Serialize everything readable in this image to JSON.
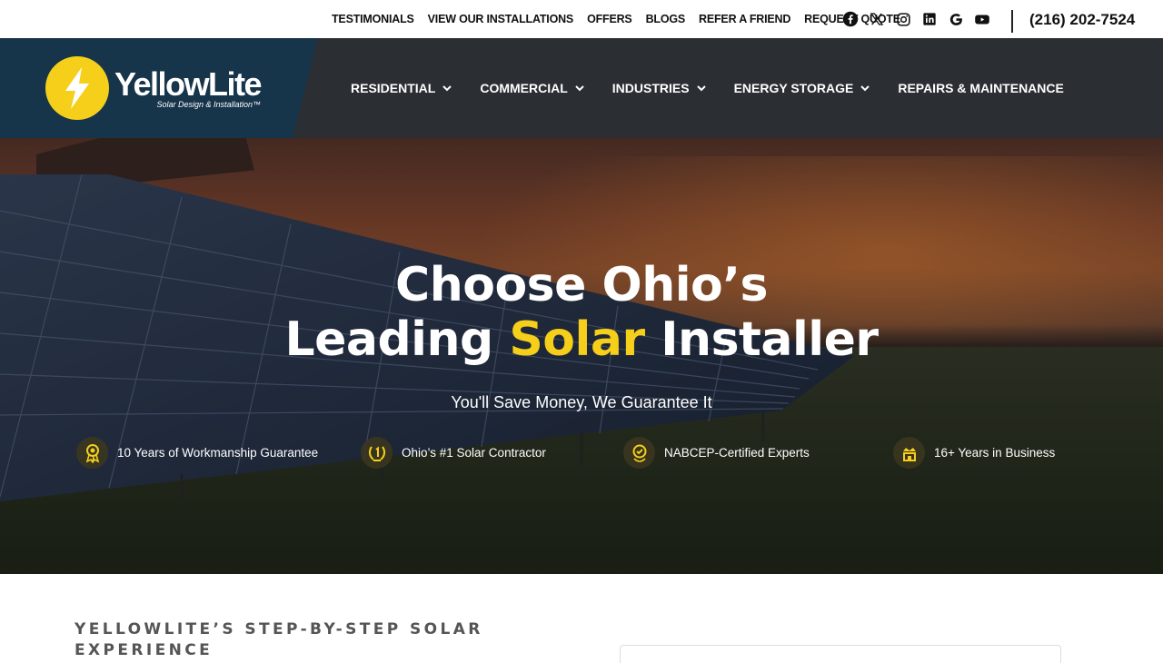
{
  "topbar": {
    "links": [
      "TESTIMONIALS",
      "VIEW OUR INSTALLATIONS",
      "OFFERS",
      "BLOGS",
      "REFER A FRIEND",
      "REQUEST QUOTE"
    ],
    "socials": [
      "facebook-icon",
      "x-twitter-icon",
      "instagram-icon",
      "linkedin-icon",
      "google-icon",
      "youtube-icon"
    ],
    "phone": "(216) 202-7524"
  },
  "logo": {
    "name": "YellowLite",
    "tagline": "Solar Design & Installation™"
  },
  "nav": {
    "items": [
      {
        "label": "RESIDENTIAL",
        "has_dropdown": true
      },
      {
        "label": "COMMERCIAL",
        "has_dropdown": true
      },
      {
        "label": "INDUSTRIES",
        "has_dropdown": true
      },
      {
        "label": "ENERGY STORAGE",
        "has_dropdown": true
      },
      {
        "label": "REPAIRS & MAINTENANCE",
        "has_dropdown": false
      }
    ]
  },
  "hero": {
    "title_line1": "Choose Ohio’s",
    "title_line2_before": "Leading ",
    "title_line2_highlight": "Solar",
    "title_line2_after": " Installer",
    "subtitle": "You'll Save Money, We Guarantee It",
    "badges": [
      {
        "icon": "award-ribbon-icon",
        "label": "10 Years of Workmanship Guarantee"
      },
      {
        "icon": "laurel-number-one-icon",
        "label": "Ohio’s #1 Solar Contractor"
      },
      {
        "icon": "certified-medal-icon",
        "label": "NABCEP-Certified Experts"
      },
      {
        "icon": "crown-building-icon",
        "label": "16+ Years in Business"
      }
    ]
  },
  "section": {
    "eyebrow": "YELLOWLITE’S STEP-BY-STEP SOLAR EXPERIENCE"
  },
  "colors": {
    "accent": "#f5cf1a",
    "nav_bg": "#2b2f33",
    "logo_panel": "#16344a",
    "text_dark": "#111111"
  }
}
